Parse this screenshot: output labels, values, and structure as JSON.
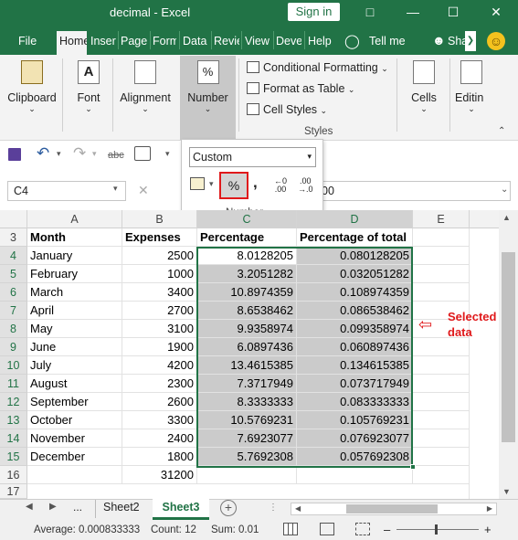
{
  "window": {
    "title": "decimal  -  Excel",
    "sign_in": "Sign in"
  },
  "tabs": [
    "File",
    "Home",
    "Inser",
    "Page",
    "Form",
    "Data",
    "Revie",
    "View",
    "Deve",
    "Help",
    "Tell me",
    "Sha"
  ],
  "ribbon": {
    "clipboard": "Clipboard",
    "font": "Font",
    "alignment": "Alignment",
    "number": "Number",
    "conditional_formatting": "Conditional Formatting",
    "format_as_table": "Format as Table",
    "cell_styles": "Cell Styles",
    "styles_group": "Styles",
    "cells": "Cells",
    "editing": "Editin",
    "percent_icon_text": "%",
    "font_icon_text": "A"
  },
  "number_popup": {
    "format": "Custom",
    "percent": "%",
    "comma": ",",
    "inc_decimal": ".00",
    "dec_decimal": ".0",
    "group_label": "Number"
  },
  "formula_bar": {
    "name_box": "C4",
    "value": "00"
  },
  "columns": [
    "A",
    "B",
    "C",
    "D",
    "E"
  ],
  "headers": {
    "a": "Month",
    "b": "Expenses",
    "c": "Percentage",
    "d": "Percentage of total"
  },
  "rows": [
    {
      "n": "3"
    },
    {
      "n": "4",
      "a": "January",
      "b": "2500",
      "c": "8.0128205",
      "d": "0.080128205"
    },
    {
      "n": "5",
      "a": "February",
      "b": "1000",
      "c": "3.2051282",
      "d": "0.032051282"
    },
    {
      "n": "6",
      "a": "March",
      "b": "3400",
      "c": "10.8974359",
      "d": "0.108974359"
    },
    {
      "n": "7",
      "a": "April",
      "b": "2700",
      "c": "8.6538462",
      "d": "0.086538462"
    },
    {
      "n": "8",
      "a": "May",
      "b": "3100",
      "c": "9.9358974",
      "d": "0.099358974"
    },
    {
      "n": "9",
      "a": "June",
      "b": "1900",
      "c": "6.0897436",
      "d": "0.060897436"
    },
    {
      "n": "10",
      "a": "July",
      "b": "4200",
      "c": "13.4615385",
      "d": "0.134615385"
    },
    {
      "n": "11",
      "a": "August",
      "b": "2300",
      "c": "7.3717949",
      "d": "0.073717949"
    },
    {
      "n": "12",
      "a": "September",
      "b": "2600",
      "c": "8.3333333",
      "d": "0.083333333"
    },
    {
      "n": "13",
      "a": "October",
      "b": "3300",
      "c": "10.5769231",
      "d": "0.105769231"
    },
    {
      "n": "14",
      "a": "November",
      "b": "2400",
      "c": "7.6923077",
      "d": "0.076923077"
    },
    {
      "n": "15",
      "a": "December",
      "b": "1800",
      "c": "5.7692308",
      "d": "0.057692308"
    },
    {
      "n": "16",
      "a": "",
      "b": "31200",
      "c": "",
      "d": ""
    },
    {
      "n": "17"
    }
  ],
  "sheets": {
    "more": "...",
    "sheet2": "Sheet2",
    "sheet3": "Sheet3"
  },
  "status": {
    "average": "Average: 0.000833333",
    "count": "Count: 12",
    "sum": "Sum: 0.01"
  },
  "annotation": "Selected data",
  "colors": {
    "excel_green": "#217346",
    "selection_shade": "#cbcbcb",
    "annotation_red": "#e0191b"
  }
}
